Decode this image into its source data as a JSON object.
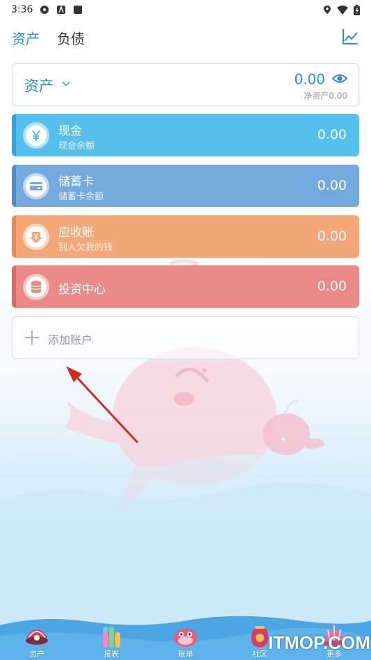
{
  "status_bar": {
    "time": "3:36",
    "left_icons": [
      "aperture-icon",
      "a-box-icon",
      "square-icon"
    ],
    "right_icons": [
      "location-icon",
      "wifi-icon",
      "battery-icon"
    ]
  },
  "header": {
    "tabs": [
      {
        "label": "资产",
        "active": true
      },
      {
        "label": "负债",
        "active": false
      }
    ],
    "chart_icon": "line-chart-icon"
  },
  "summary": {
    "title": "资产",
    "total": "0.00",
    "net_label": "净资产0.00",
    "accent": "#2a8fd3"
  },
  "accounts": [
    {
      "name": "现金",
      "sub": "现金余额",
      "amount": "0.00",
      "icon": "yen-icon",
      "color": "#56c0ec"
    },
    {
      "name": "储蓄卡",
      "sub": "储蓄卡余额",
      "amount": "0.00",
      "icon": "card-icon",
      "color": "#74a9de"
    },
    {
      "name": "应收账",
      "sub": "别人欠我的钱",
      "amount": "0.00",
      "icon": "receivable-icon",
      "color": "#f3a87a"
    },
    {
      "name": "投资中心",
      "sub": "",
      "amount": "0.00",
      "icon": "coin-stack-icon",
      "color": "#ea8a86"
    }
  ],
  "add_account": {
    "label": "添加账户"
  },
  "bottom_nav": [
    {
      "label": "资产",
      "icon": "shell-icon"
    },
    {
      "label": "报表",
      "icon": "coral-icon"
    },
    {
      "label": "账单",
      "icon": "fish-icon"
    },
    {
      "label": "社区",
      "icon": "lucky-bag-icon"
    },
    {
      "label": "更多",
      "icon": "pink-shell-icon"
    }
  ],
  "watermark": "ITMOP.COM"
}
